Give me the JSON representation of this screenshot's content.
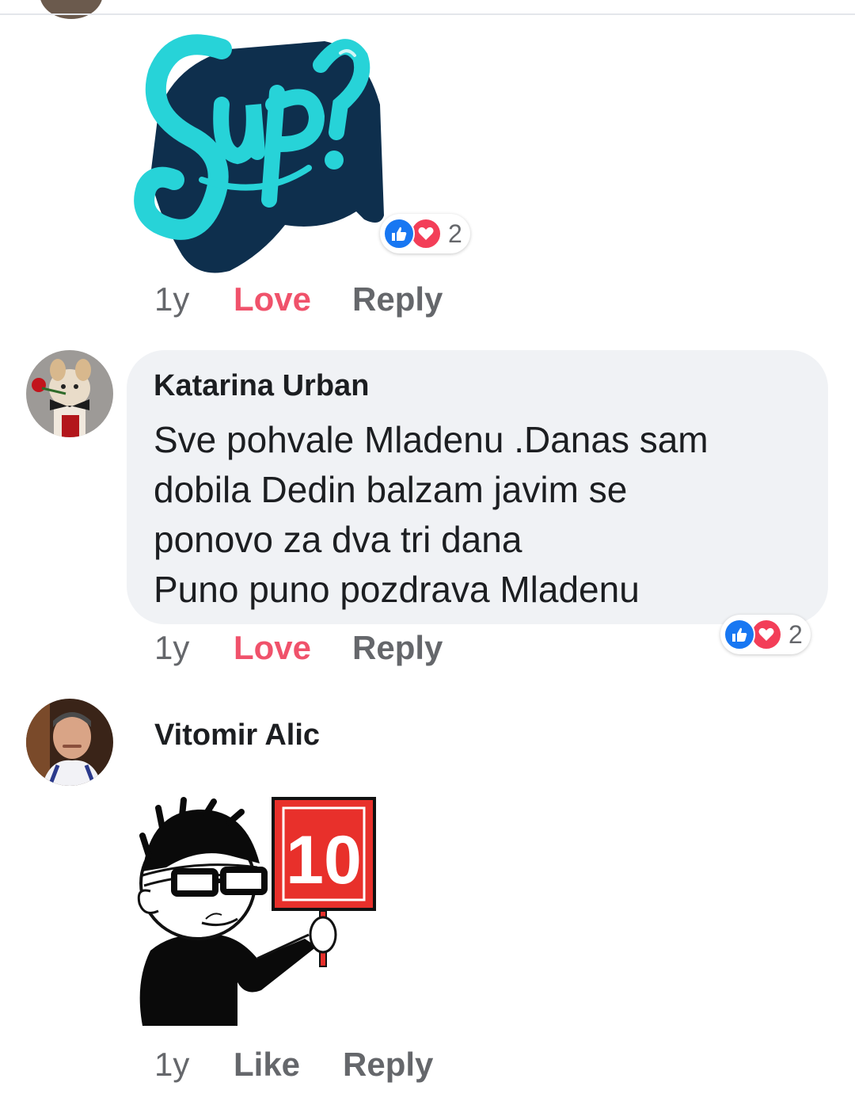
{
  "comments": [
    {
      "sticker": "sup-sticker",
      "sticker_text": "Sup?",
      "reactions": {
        "icons": [
          "like-icon",
          "love-icon"
        ],
        "count": "2"
      },
      "time": "1y",
      "react_label": "Love",
      "reply_label": "Reply"
    },
    {
      "author": "Katarina Urban",
      "text_lines": [
        "Sve pohvale Mladenu .Danas sam",
        "dobila Dedin balzam javim se",
        "ponovo za dva tri dana",
        "Puno puno pozdrava Mladenu"
      ],
      "reactions": {
        "icons": [
          "like-icon",
          "love-icon"
        ],
        "count": "2"
      },
      "time": "1y",
      "react_label": "Love",
      "reply_label": "Reply"
    },
    {
      "author": "Vitomir Alic",
      "sticker": "score-ten-sticker",
      "sticker_text": "10",
      "time": "1y",
      "react_label": "Like",
      "reply_label": "Reply"
    }
  ],
  "colors": {
    "love": "#f0526b",
    "like_blue": "#1877f2",
    "bubble": "#f0f2f5",
    "meta_gray": "#65676b",
    "sup_teal": "#27d3d8",
    "sup_navy": "#0e2f4d",
    "sign_red": "#e8302b"
  }
}
